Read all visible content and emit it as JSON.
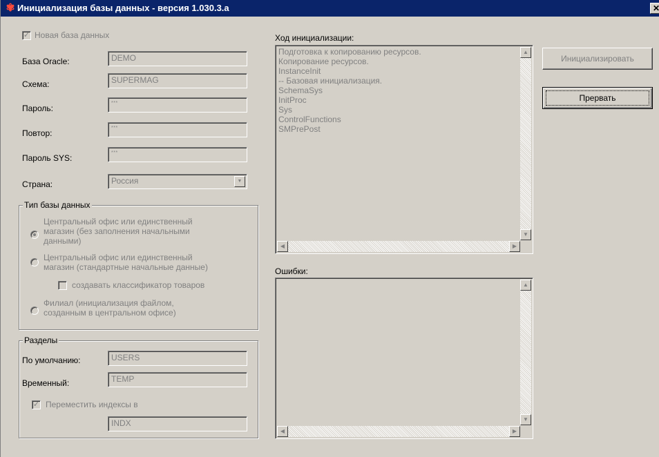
{
  "window": {
    "title": "Инициализация базы данных - версия 1.030.3.a",
    "icon": "app-icon",
    "close_label": "✕"
  },
  "form": {
    "new_db": {
      "label": "Новая база данных",
      "checked": true,
      "enabled": false
    },
    "oracle_db": {
      "label": "База Oracle:",
      "value": "DEMO"
    },
    "schema": {
      "label": "Схема:",
      "value": "SUPERMAG"
    },
    "password": {
      "label": "Пароль:",
      "value": "***"
    },
    "repeat": {
      "label": "Повтор:",
      "value": "***"
    },
    "sys_password": {
      "label": "Пароль SYS:",
      "value": "***"
    },
    "country": {
      "label": "Страна:",
      "value": "Россия"
    }
  },
  "db_type": {
    "title": "Тип базы данных",
    "options": [
      {
        "line1": "Центральный офис или единственный",
        "line2": "магазин (без заполнения начальными",
        "line3": "данными)",
        "selected": true
      },
      {
        "line1": "Центральный офис или единственный",
        "line2": "магазин (стандартные начальные данные)",
        "selected": false
      },
      {
        "line1": "Филиал (инициализация файлом,",
        "line2": "созданным в центральном офисе)",
        "selected": false
      }
    ],
    "classifier_checkbox": {
      "label": "создавать классификатор товаров",
      "checked": false
    }
  },
  "sections": {
    "title": "Разделы",
    "default": {
      "label": "По умолчанию:",
      "value": "USERS"
    },
    "temporary": {
      "label": "Временный:",
      "value": "TEMP"
    },
    "move_indexes": {
      "label": "Переместить индексы в",
      "checked": true
    },
    "index_tablespace": {
      "value": "INDX"
    }
  },
  "progress": {
    "label": "Ход инициализации:",
    "lines": [
      "Подготовка к копированию ресурсов.",
      "Копирование ресурсов.",
      "InstanceInit",
      "-- Базовая инициализация.",
      "SchemaSys",
      "InitProc",
      "Sys",
      "ControlFunctions",
      "SMPrePost"
    ]
  },
  "errors": {
    "label": "Ошибки:",
    "lines": []
  },
  "buttons": {
    "initialize": "Инициализировать",
    "abort": "Прервать"
  },
  "colors": {
    "titlebar": "#0a246a",
    "face": "#d4d0c8",
    "disabled_text": "#808080"
  }
}
